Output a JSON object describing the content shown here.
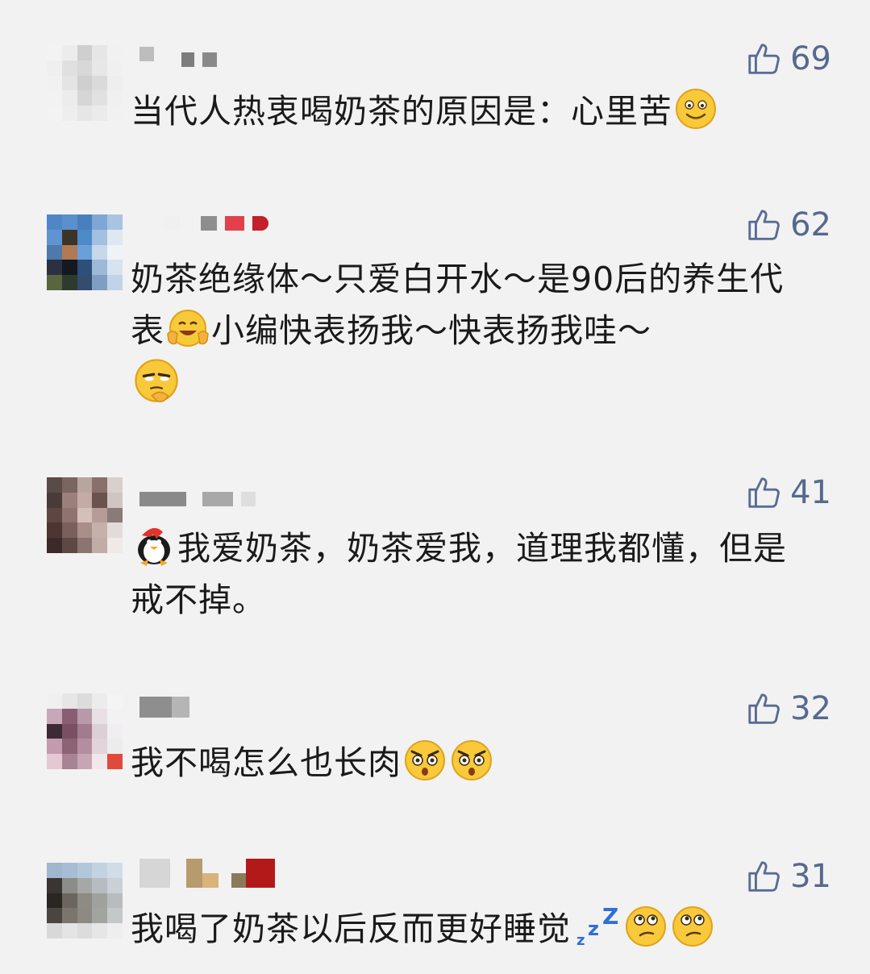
{
  "comments": [
    {
      "likes": "69",
      "text": "当代人热衷喝奶茶的原因是：心里苦",
      "emojis_after": [
        "smile-emoji"
      ]
    },
    {
      "likes": "62",
      "text_parts": [
        "奶茶绝缘体～只爱白开水～是90后的养生代表",
        "小编快表扬我～快表扬我哇～"
      ],
      "emojis": [
        "cheeky-hands-emoji",
        "smirk-thinking-emoji"
      ]
    },
    {
      "likes": "41",
      "text": "我爱奶茶，奶茶爱我，道理我都懂，但是戒不掉。",
      "emojis_before": [
        "penguin-emoji"
      ]
    },
    {
      "likes": "32",
      "text": "我不喝怎么也长肉",
      "emojis_after": [
        "shocked-emoji",
        "shocked-emoji"
      ]
    },
    {
      "likes": "31",
      "text": "我喝了奶茶以后反而更好睡觉",
      "emojis_after": [
        "zzz-emoji",
        "puzzled-emoji",
        "puzzled-emoji"
      ]
    }
  ]
}
